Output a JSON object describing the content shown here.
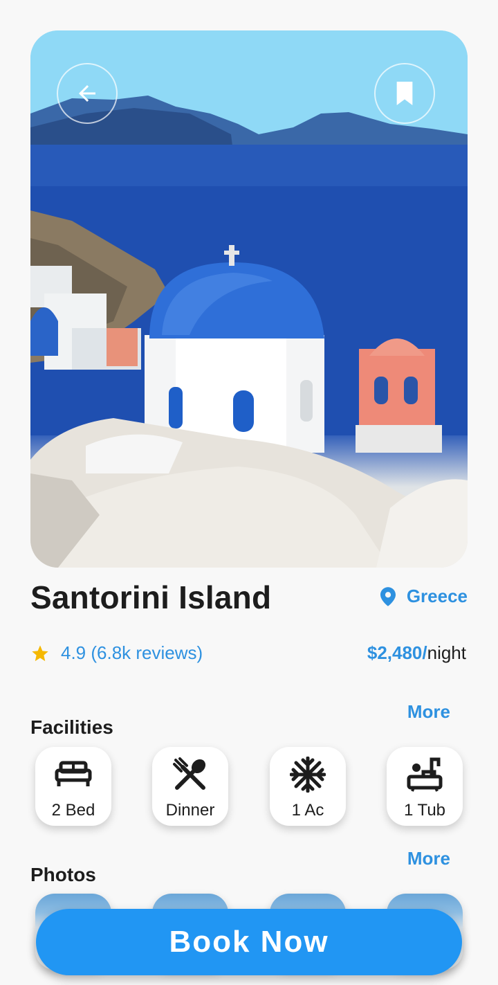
{
  "place": {
    "name": "Santorini Island",
    "location": "Greece",
    "rating": "4.9 (6.8k reviews)",
    "price": "$2,480/",
    "price_unit": "night"
  },
  "icons": {
    "back": "arrow-back-icon",
    "bookmark": "bookmark-icon",
    "location": "location-pin-icon",
    "rating": "star-icon"
  },
  "facilities": {
    "title": "Facilities",
    "more_label": "More",
    "items": [
      {
        "label": "2 Bed",
        "icon": "bed-icon"
      },
      {
        "label": "Dinner",
        "icon": "utensils-icon"
      },
      {
        "label": "1 Ac",
        "icon": "snowflake-icon"
      },
      {
        "label": "1 Tub",
        "icon": "bathtub-icon"
      }
    ]
  },
  "photos": {
    "title": "Photos",
    "more_label": "More",
    "count_visible": 4
  },
  "book_button": {
    "label": "Book Now"
  },
  "colors": {
    "accent": "#2e91e0",
    "button": "#2196f3",
    "star": "#f5b800",
    "background": "#f8f8f8"
  }
}
